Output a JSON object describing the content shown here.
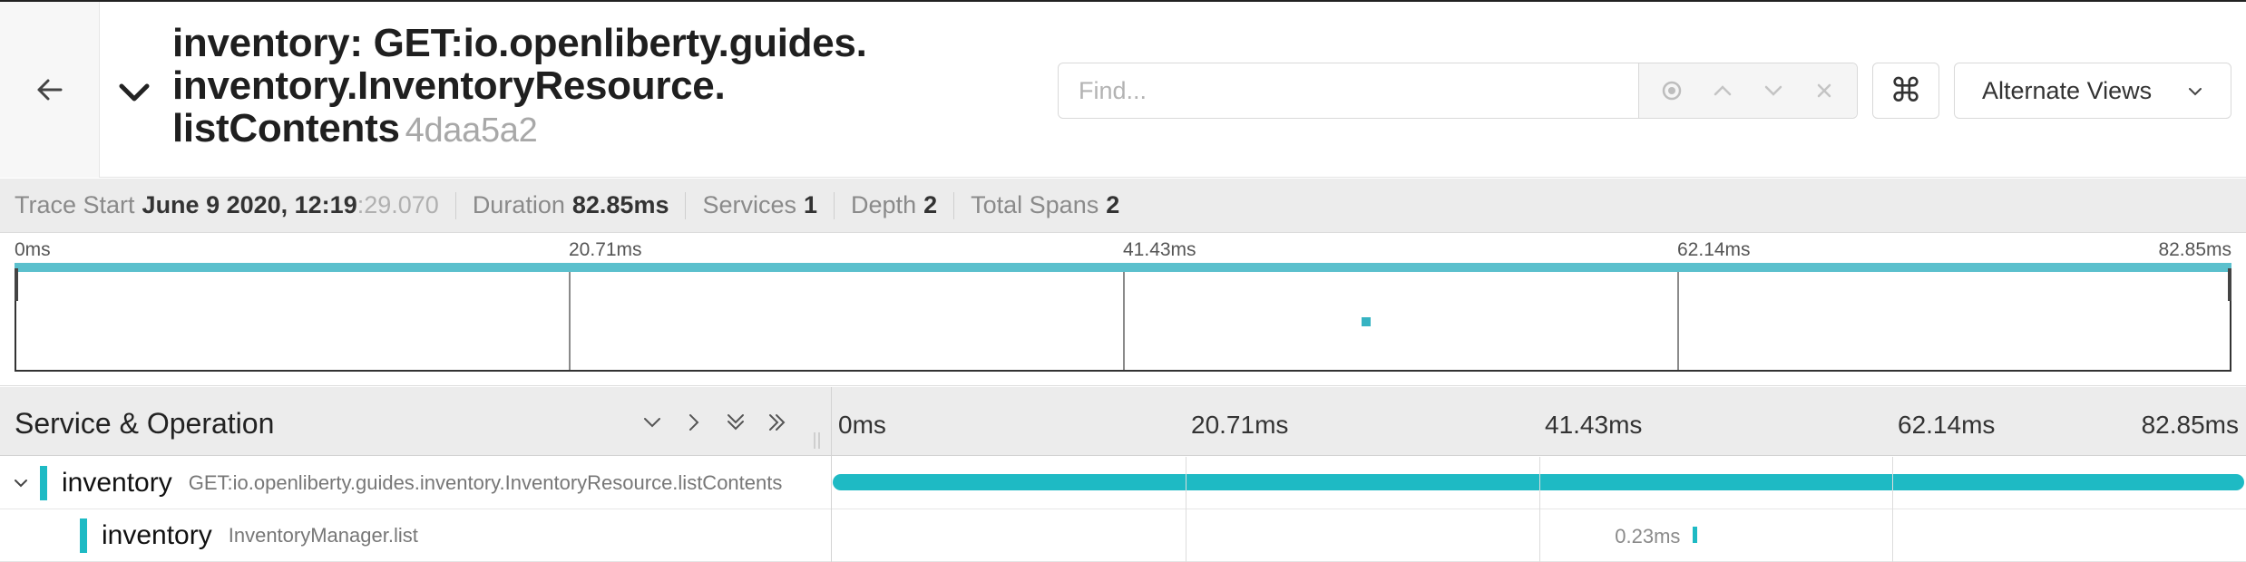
{
  "header": {
    "back_icon": "arrow-left-icon",
    "collapse_icon": "chevron-down-icon",
    "title_line1": "inventory: GET:io.openliberty.guides.",
    "title_line2": "inventory.InventoryResource.",
    "title_line3": "listContents",
    "trace_id": "4daa5a2",
    "find": {
      "placeholder": "Find...",
      "value": "",
      "tools": [
        "locate-icon",
        "chevron-up-icon",
        "chevron-down-icon",
        "close-icon"
      ]
    },
    "keyboard_shortcuts_glyph": "⌘",
    "alternate_views_label": "Alternate Views"
  },
  "summary": {
    "trace_start_label": "Trace Start",
    "trace_start_value": "June 9 2020, 12:19",
    "trace_start_seconds": ":29.070",
    "duration_label": "Duration",
    "duration_value": "82.85ms",
    "services_label": "Services",
    "services_value": "1",
    "depth_label": "Depth",
    "depth_value": "2",
    "total_spans_label": "Total Spans",
    "total_spans_value": "2"
  },
  "minimap": {
    "ticks": [
      "0ms",
      "20.71ms",
      "41.43ms",
      "62.14ms",
      "82.85ms"
    ]
  },
  "timeline": {
    "column_title": "Service & Operation",
    "controls": [
      "chevron-down-icon",
      "chevron-right-icon",
      "double-chevron-down-icon",
      "double-chevron-right-icon"
    ],
    "ticks": [
      "0ms",
      "20.71ms",
      "41.43ms",
      "62.14ms",
      "82.85ms"
    ],
    "span_color": "#1ebac4",
    "rows": [
      {
        "service": "inventory",
        "operation": "GET:io.openliberty.guides.inventory.InventoryResource.listContents",
        "start_ms": 0,
        "duration_ms": 82.85,
        "duration_label": ""
      },
      {
        "service": "inventory",
        "operation": "InventoryManager.list",
        "start_ms": 50.5,
        "duration_ms": 0.23,
        "duration_label": "0.23ms"
      }
    ]
  }
}
